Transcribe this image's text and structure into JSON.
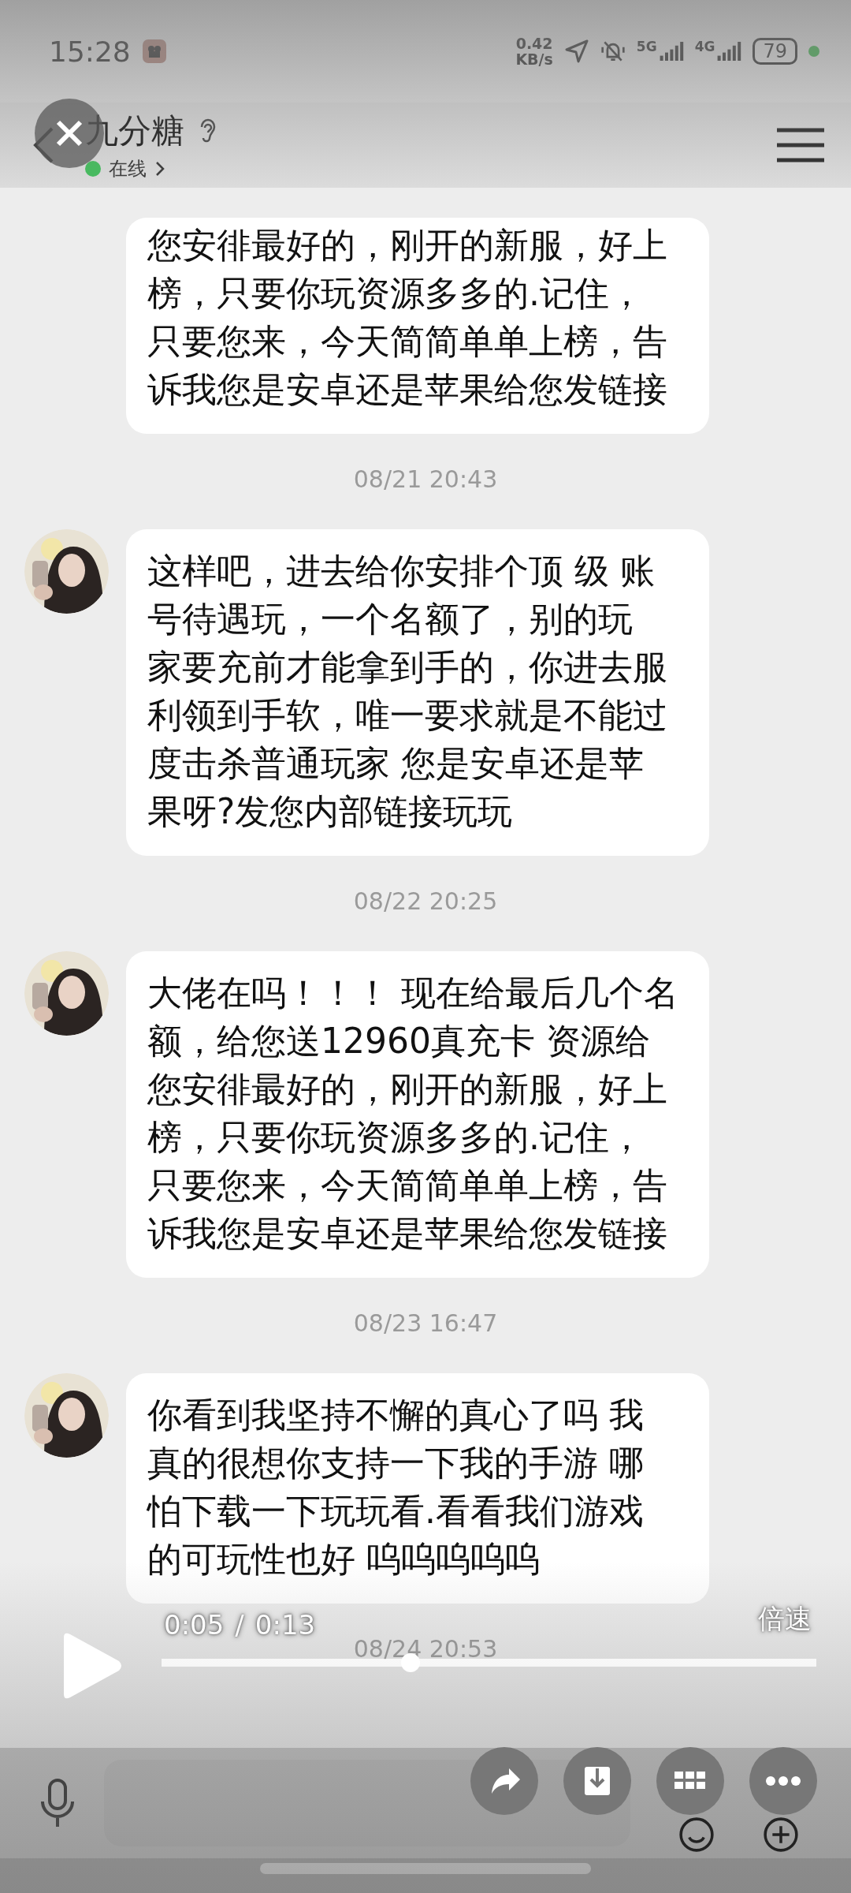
{
  "status_bar": {
    "time": "15:28",
    "net_speed": "0.42",
    "net_unit": "KB/s",
    "signal_1": "5G",
    "signal_2": "4G",
    "battery": "79"
  },
  "header": {
    "title": "九分糖",
    "presence": "在线",
    "online": true
  },
  "messages": [
    {
      "kind": "bubble",
      "avatar": false,
      "lines": [
        "您安徘最好的，刚开的新服，好上",
        "榜，只要你玩资源多多的.记住，",
        "只要您来，今天简简单单上榜，告",
        "诉我您是安卓还是苹果给您发链接"
      ]
    },
    {
      "kind": "time",
      "text": "08/21 20:43"
    },
    {
      "kind": "bubble",
      "avatar": true,
      "lines": [
        "这样吧，进去给你安排个顶 级 账",
        "号待遇玩，一个名额了，别的玩",
        "家要充前才能拿到手的，你进去服",
        "利领到手软，唯一要求就是不能过",
        "度击杀普通玩家 您是安卓还是苹",
        "果呀?发您内部链接玩玩"
      ]
    },
    {
      "kind": "time",
      "text": "08/22 20:25"
    },
    {
      "kind": "bubble",
      "avatar": true,
      "lines": [
        "大佬在吗！！！ 现在给最后几个名",
        "额，给您送12960真充卡 资源给",
        "您安徘最好的，刚开的新服，好上",
        "榜，只要你玩资源多多的.记住，",
        "只要您来，今天简简单单上榜，告",
        "诉我您是安卓还是苹果给您发链接"
      ]
    },
    {
      "kind": "time",
      "text": "08/23 16:47"
    },
    {
      "kind": "bubble",
      "avatar": true,
      "lines": [
        "你看到我坚持不懈的真心了吗 我",
        "真的很想你支持一下我的手游 哪",
        "怕下载一下玩玩看.看看我们游戏",
        "的可玩性也好 呜呜呜呜呜"
      ]
    },
    {
      "kind": "time",
      "text": "08/24 20:53"
    }
  ],
  "player": {
    "elapsed": "0:05",
    "separator": "/",
    "duration": "0:13",
    "speed": "倍速",
    "level": 0.38,
    "playing": false
  }
}
